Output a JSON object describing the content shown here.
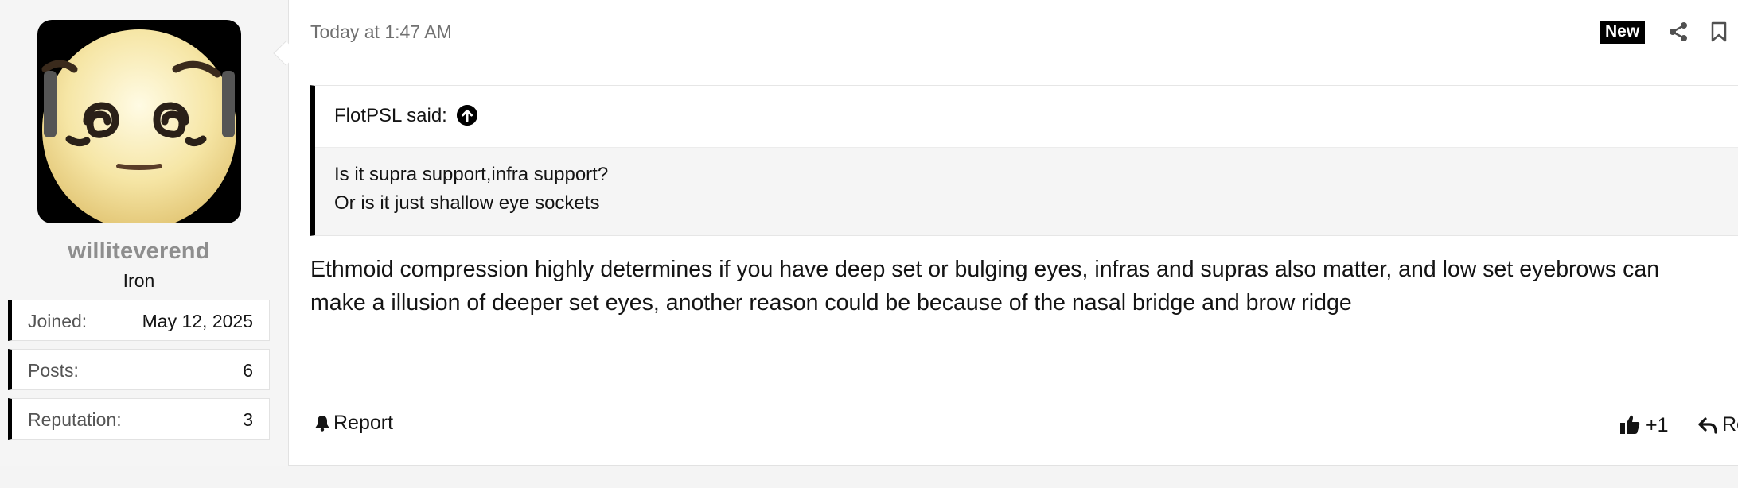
{
  "post": {
    "user": {
      "username": "williteverend",
      "title": "Iron",
      "stats": [
        {
          "label": "Joined:",
          "value": "May 12, 2025"
        },
        {
          "label": "Posts:",
          "value": "6"
        },
        {
          "label": "Reputation:",
          "value": "3"
        }
      ]
    },
    "timestamp": "Today at 1:47 AM",
    "badge": "New",
    "quote": {
      "author": "FlotPSL said:",
      "lines": [
        "Is it supra support,infra support?",
        "Or is it just shallow eye sockets"
      ]
    },
    "message_lines": [
      "Ethmoid compression highly determines if you have deep set or bulging eyes, infras and supras also matter, and low set eyebrows can",
      "make a illusion of deeper set eyes, another reason could be because of the nasal bridge and brow ridge"
    ],
    "actions": {
      "report": "Report",
      "like_count": "+1",
      "reply": "Re"
    }
  },
  "colors": {
    "accent": "#000000",
    "username": "#8e8e8e",
    "muted": "#707070"
  },
  "icons": [
    "share-icon",
    "bookmark-icon",
    "quote-jump-up-icon",
    "bell-icon",
    "thumbs-up-icon",
    "reply-icon"
  ]
}
